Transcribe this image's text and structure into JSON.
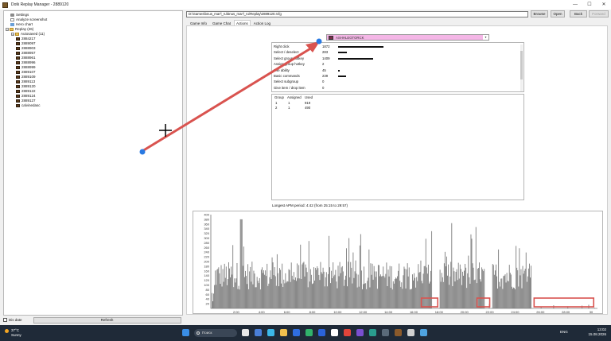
{
  "window": {
    "title": "Dotk Replay Manager - 2889120",
    "minimize": "—",
    "maximize": "☐",
    "close": "✕"
  },
  "tree": {
    "items": [
      {
        "label": "Settings",
        "icon": "gear-icon"
      },
      {
        "label": "Analyze screenshot",
        "icon": "document-icon"
      },
      {
        "label": "Hero chart",
        "icon": "chart-icon"
      },
      {
        "label": "Replay (26)",
        "icon": "folder-icon"
      },
      {
        "label": "Autosaved (11)",
        "icon": "folder-icon"
      },
      {
        "label": "2884217",
        "icon": "replay-icon"
      },
      {
        "label": "2889097",
        "icon": "replay-icon"
      },
      {
        "label": "2888903",
        "icon": "replay-icon"
      },
      {
        "label": "2888957",
        "icon": "replay-icon"
      },
      {
        "label": "2888961",
        "icon": "replay-icon"
      },
      {
        "label": "2888996",
        "icon": "replay-icon"
      },
      {
        "label": "2888999",
        "icon": "replay-icon"
      },
      {
        "label": "2889107",
        "icon": "replay-icon"
      },
      {
        "label": "2889109",
        "icon": "replay-icon"
      },
      {
        "label": "2889113",
        "icon": "replay-icon"
      },
      {
        "label": "2889120",
        "icon": "replay-icon"
      },
      {
        "label": "2889122",
        "icon": "replay-icon"
      },
      {
        "label": "2889124",
        "icon": "replay-icon"
      },
      {
        "label": "2889127",
        "icon": "replay-icon"
      },
      {
        "label": "calvinedasc",
        "icon": "replay-icon"
      }
    ]
  },
  "bottom": {
    "checkbox_label": "Dis date",
    "refresh_label": "Refresh"
  },
  "toolbar": {
    "path": "D:\\Games\\bnus_mar'l_ru\\bnus_mar'l_ru\\Replay\\2889120.rcfg",
    "browse": "Browse",
    "open": "Open",
    "back": "Back",
    "forward": "Forward"
  },
  "tabs": [
    "Game Info",
    "Game Chat",
    "Actions",
    "Action Log"
  ],
  "active_tab": "Actions",
  "player": {
    "name": "ASHHLEGTORCK",
    "color": "#7a2d4a"
  },
  "stats": [
    {
      "label": "Right click",
      "value": "1872",
      "bar": 0.6
    },
    {
      "label": "Select / deselect",
      "value": "283",
      "bar": 0.12
    },
    {
      "label": "Select group hotkey",
      "value": "1409",
      "bar": 0.46
    },
    {
      "label": "Assign group hotkey",
      "value": "2",
      "bar": 0.0
    },
    {
      "label": "Use ability",
      "value": "45",
      "bar": 0.02
    },
    {
      "label": "Basic commands",
      "value": "239",
      "bar": 0.1
    },
    {
      "label": "Select subgroup",
      "value": "0",
      "bar": 0.0
    },
    {
      "label": "Give item / drop item",
      "value": "0",
      "bar": 0.0
    }
  ],
  "groups": {
    "headers": [
      "Group",
      "Assigned",
      "Used"
    ],
    "rows": [
      [
        "1",
        "1",
        "919"
      ],
      [
        "2",
        "1",
        "490"
      ]
    ]
  },
  "apm_period": "Longest APM period: 4:42 (from 25:15 to 29:57)",
  "chart_data": {
    "type": "bar",
    "x_ticks": [
      "2:00",
      "4:00",
      "6:00",
      "8:00",
      "10:00",
      "12:00",
      "14:00",
      "16:00",
      "18:00",
      "20:00",
      "22:00",
      "24:00",
      "26:00",
      "28:00",
      "30"
    ],
    "y_ticks": [
      20,
      40,
      60,
      80,
      100,
      120,
      140,
      160,
      180,
      200,
      220,
      240,
      260,
      280,
      300,
      320,
      340,
      360,
      380,
      400
    ],
    "ylim": [
      0,
      400
    ],
    "xlim_minutes": [
      0,
      30.5
    ],
    "bar_color": "#7d7d7d",
    "gap_minutes": [
      [
        17.4,
        18.0
      ],
      [
        21.6,
        22.2
      ],
      [
        25.3,
        30.5
      ]
    ],
    "highlight_minutes": [
      [
        16.6,
        17.9
      ],
      [
        21.0,
        22.0
      ],
      [
        25.5,
        30.2
      ]
    ],
    "highlight_color": "#d9534f"
  },
  "annotation": {
    "arrow_color": "#d9534f",
    "dot_color": "#2a7ae2"
  },
  "taskbar": {
    "weather_temp": "37°C",
    "weather_text": "Sunny",
    "search_placeholder": "Поиск",
    "lang": "ENG",
    "time": "13:02",
    "date": "15.08.2026"
  }
}
